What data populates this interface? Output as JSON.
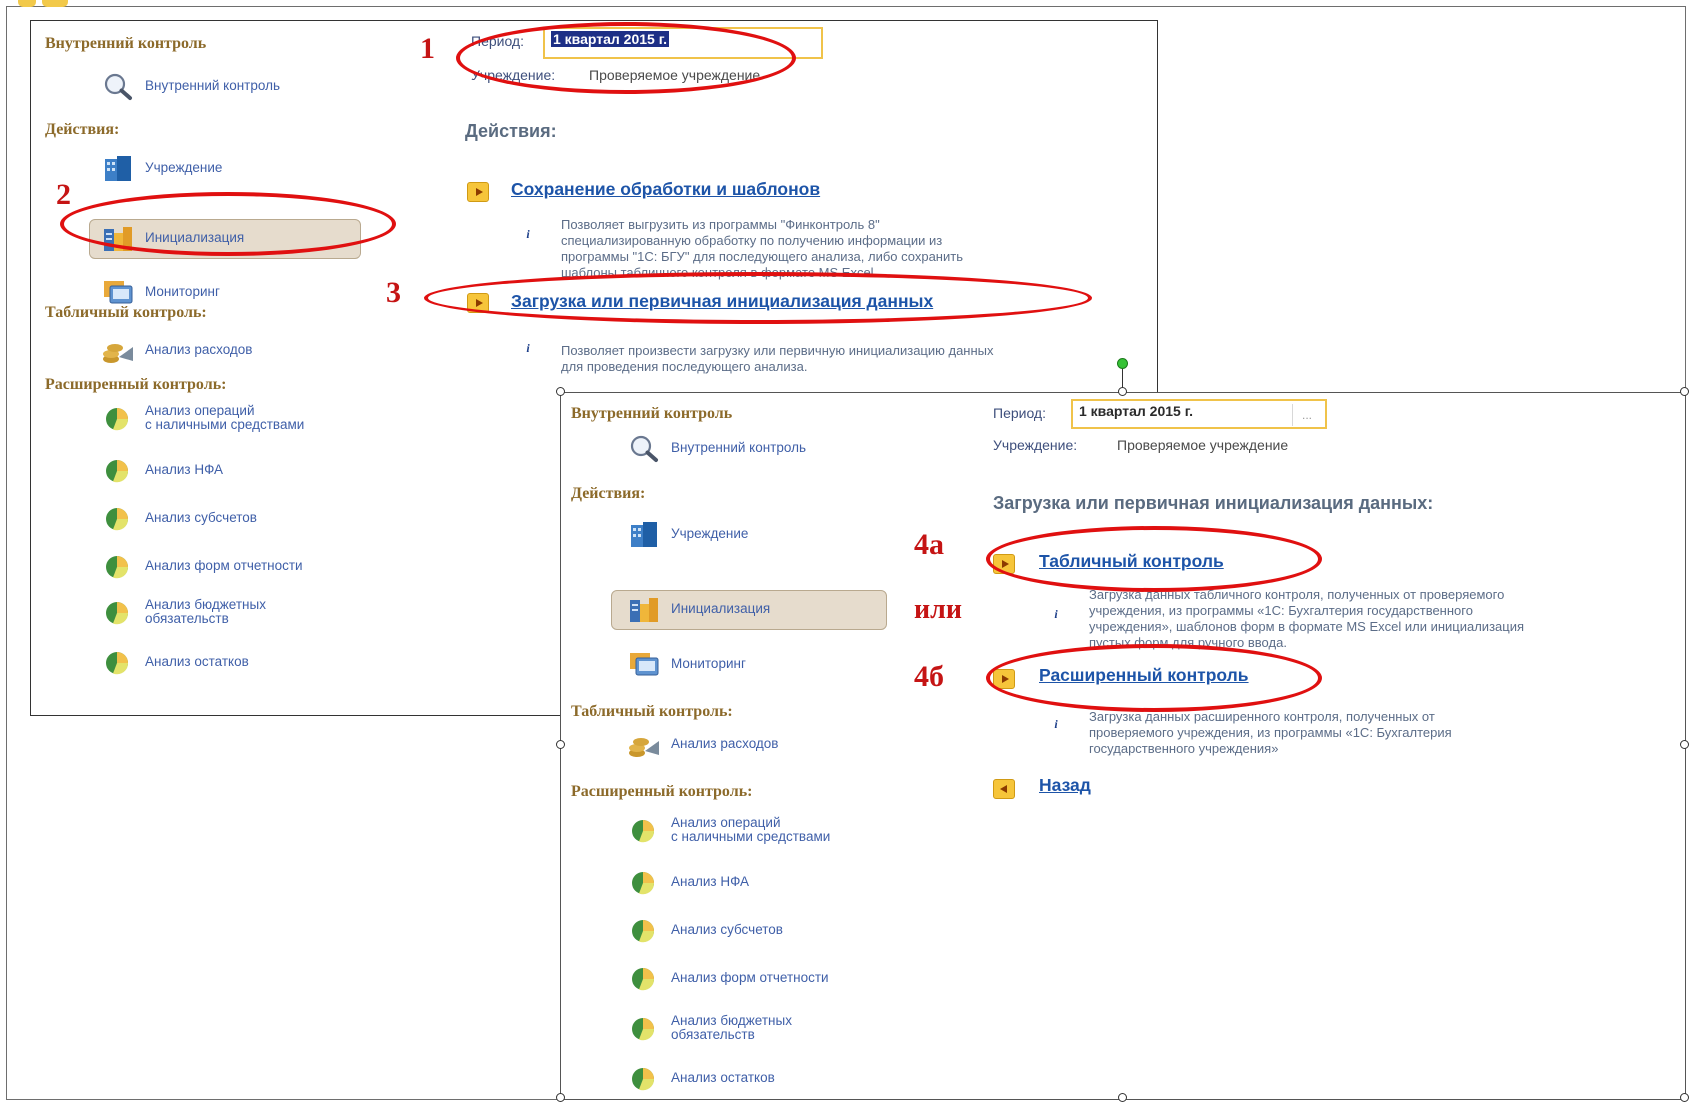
{
  "window1": {
    "sections": {
      "internal_control": "Внутренний контроль",
      "actions": "Действия:",
      "tabular_control": "Табличный контроль:",
      "extended_control": "Расширенный контроль:"
    },
    "items": {
      "internal_control": "Внутренний контроль",
      "institution": "Учреждение",
      "initialization": "Инициализация",
      "monitoring": "Мониторинг",
      "expense_analysis": "Анализ расходов",
      "cash_operations": "Анализ операций\nс наличными средствами",
      "nfa": "Анализ НФА",
      "subaccounts": "Анализ субсчетов",
      "report_forms": "Анализ форм отчетности",
      "budget_obligations": "Анализ бюджетных\nобязательств",
      "balances": "Анализ остатков"
    },
    "period_label": "Период:",
    "period_value": "1 квартал 2015 г.",
    "institution_label": "Учреждение:",
    "institution_value": "Проверяемое учреждение",
    "actions_heading": "Действия:",
    "link_save": "Сохранение обработки и шаблонов",
    "desc_save": "Позволяет выгрузить из программы \"Финконтроль 8\"\nспециализированную обработку по получению информации из\nпрограммы \"1С: БГУ\" для последующего анализа, либо сохранить\nшаблоны табличного контроля в формате MS Excel",
    "link_load": "Загрузка или первичная инициализация данных",
    "desc_load": "Позволяет произвести загрузку или первичную инициализацию данных\nдля проведения последующего анализа."
  },
  "window2": {
    "sections": {
      "internal_control": "Внутренний контроль",
      "actions": "Действия:",
      "tabular_control": "Табличный контроль:",
      "extended_control": "Расширенный контроль:"
    },
    "items": {
      "internal_control": "Внутренний контроль",
      "institution": "Учреждение",
      "initialization": "Инициализация",
      "monitoring": "Мониторинг",
      "expense_analysis": "Анализ расходов",
      "cash_operations": "Анализ операций\nс наличными средствами",
      "nfa": "Анализ НФА",
      "subaccounts": "Анализ субсчетов",
      "report_forms": "Анализ форм отчетности",
      "budget_obligations": "Анализ бюджетных\nобязательств",
      "balances": "Анализ остатков"
    },
    "period_label": "Период:",
    "period_value": "1 квартал 2015 г.",
    "period_picker": "...",
    "institution_label": "Учреждение:",
    "institution_value": "Проверяемое учреждение",
    "heading": "Загрузка или первичная инициализация данных:",
    "link_tabular": "Табличный контроль",
    "desc_tabular": "Загрузка данных табличного контроля, полученных от проверяемого\nучреждения, из программы «1С: Бухгалтерия государственного\nучреждения», шаблонов форм в формате MS Excel или инициализация\nпустых форм для ручного ввода.",
    "link_extended": "Расширенный контроль",
    "desc_extended": "Загрузка данных расширенного контроля, полученных от\nпроверяемого учреждения, из программы «1С: Бухгалтерия\nгосударственного учреждения»",
    "link_back": "Назад"
  },
  "annotations": {
    "step1": "1",
    "step2": "2",
    "step3": "3",
    "step4a": "4а",
    "step4b": "4б",
    "or": "или"
  },
  "colors": {
    "annotation_red": "#e01010",
    "section_brown": "#8c6a2a",
    "link_blue": "#1d54a8",
    "selected_bg": "#e6dccd"
  },
  "icons": {
    "search": "magnifier-icon",
    "institution": "building-icon",
    "initialization": "database-icon",
    "monitoring": "monitor-icon",
    "expense": "coins-icon",
    "analysis": "pie-ball-icon"
  }
}
